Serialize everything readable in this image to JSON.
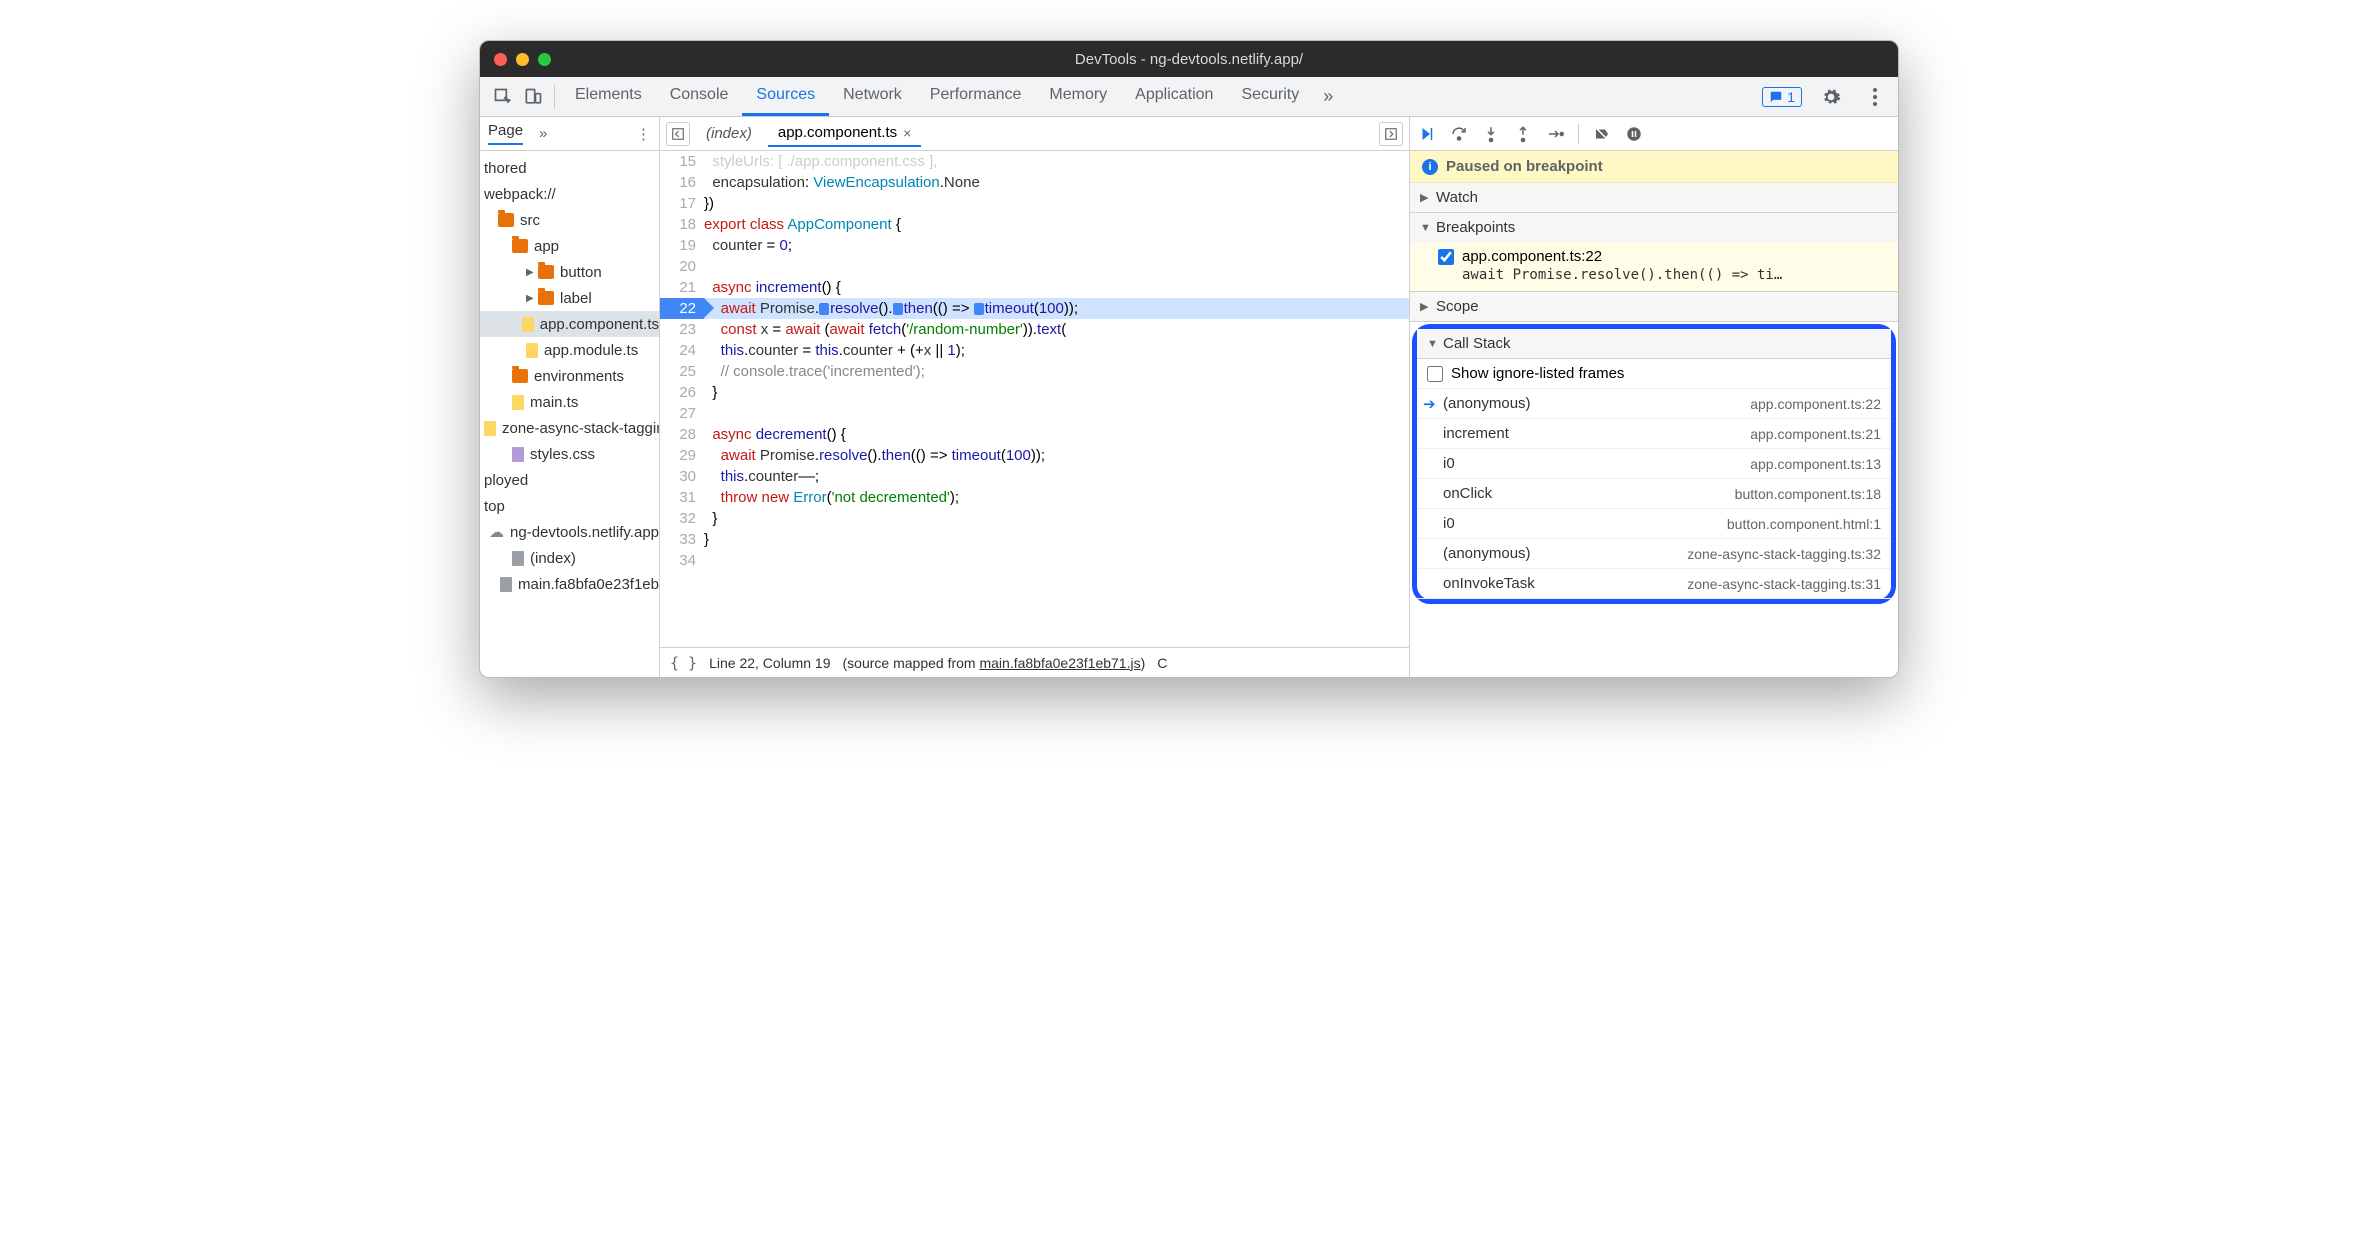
{
  "title": "DevTools - ng-devtools.netlify.app/",
  "toolbar": {
    "tabs": [
      "Elements",
      "Console",
      "Sources",
      "Network",
      "Performance",
      "Memory",
      "Application",
      "Security"
    ],
    "active": "Sources",
    "issue_count": "1"
  },
  "nav": {
    "tab": "Page",
    "items": [
      {
        "label": "thored",
        "indent": 0,
        "type": "text"
      },
      {
        "label": "webpack://",
        "indent": 0,
        "type": "text"
      },
      {
        "label": "src",
        "indent": 1,
        "type": "folder"
      },
      {
        "label": "app",
        "indent": 2,
        "type": "folder"
      },
      {
        "label": "button",
        "indent": 3,
        "type": "folder",
        "expander": "▶"
      },
      {
        "label": "label",
        "indent": 3,
        "type": "folder",
        "expander": "▶"
      },
      {
        "label": "app.component.ts",
        "indent": 3,
        "type": "file",
        "sel": true
      },
      {
        "label": "app.module.ts",
        "indent": 3,
        "type": "file"
      },
      {
        "label": "environments",
        "indent": 2,
        "type": "folder"
      },
      {
        "label": "main.ts",
        "indent": 2,
        "type": "file"
      },
      {
        "label": "zone-async-stack-tagging",
        "indent": 2,
        "type": "file",
        "trunc": true
      },
      {
        "label": "styles.css",
        "indent": 2,
        "type": "file",
        "css": true
      },
      {
        "label": "ployed",
        "indent": 0,
        "type": "text"
      },
      {
        "label": "top",
        "indent": 0,
        "type": "text"
      },
      {
        "label": "ng-devtools.netlify.app",
        "indent": 1,
        "type": "cloud"
      },
      {
        "label": "(index)",
        "indent": 2,
        "type": "file",
        "gray": true
      },
      {
        "label": "main.fa8bfa0e23f1eb",
        "indent": 2,
        "type": "file",
        "gray": true,
        "trunc": true
      }
    ]
  },
  "editor": {
    "tab_inactive": "(index)",
    "tab_active": "app.component.ts",
    "status": {
      "line_col": "Line 22, Column 19",
      "mapped_prefix": "(source mapped from ",
      "mapped_link": "main.fa8bfa0e23f1eb71.js",
      "mapped_suffix": ")",
      "coverage_short": "C"
    },
    "lines": [
      {
        "n": 15,
        "raw": "styleUrls: [ ./app.component.css ],",
        "off": true
      },
      {
        "n": 16,
        "t": [
          [
            "  ",
            "p"
          ],
          [
            "encapsulation",
            "id"
          ],
          [
            ": ",
            "p"
          ],
          [
            "ViewEncapsulation",
            "cls"
          ],
          [
            ".",
            "p"
          ],
          [
            "None",
            "id"
          ]
        ]
      },
      {
        "n": 17,
        "t": [
          [
            "})",
            "p"
          ]
        ]
      },
      {
        "n": 18,
        "t": [
          [
            "export",
            "kw"
          ],
          [
            " ",
            "p"
          ],
          [
            "class",
            "kw"
          ],
          [
            " ",
            "p"
          ],
          [
            "AppComponent",
            "cls"
          ],
          [
            " {",
            "p"
          ]
        ]
      },
      {
        "n": 19,
        "t": [
          [
            "  ",
            "p"
          ],
          [
            "counter",
            "id"
          ],
          [
            " = ",
            "p"
          ],
          [
            "0",
            "num"
          ],
          [
            ";",
            "p"
          ]
        ]
      },
      {
        "n": 20,
        "t": [
          [
            "",
            "p"
          ]
        ]
      },
      {
        "n": 21,
        "t": [
          [
            "  ",
            "p"
          ],
          [
            "async",
            "kw"
          ],
          [
            " ",
            "p"
          ],
          [
            "increment",
            "fn"
          ],
          [
            "() {",
            "p"
          ]
        ]
      },
      {
        "n": 22,
        "cur": true,
        "t": [
          [
            "    ",
            "p"
          ],
          [
            "await",
            "kw"
          ],
          [
            " ",
            "p"
          ],
          [
            "Promise",
            "id"
          ],
          [
            ".",
            "p"
          ],
          [
            "HINT",
            ""
          ],
          [
            "resolve",
            "fn"
          ],
          [
            "().",
            "p"
          ],
          [
            "HINT",
            ""
          ],
          [
            "then",
            "fn"
          ],
          [
            "(() => ",
            "p"
          ],
          [
            "HINT",
            ""
          ],
          [
            "timeout",
            "fn"
          ],
          [
            "(",
            "p"
          ],
          [
            "100",
            "num"
          ],
          [
            "));",
            "p"
          ]
        ]
      },
      {
        "n": 23,
        "t": [
          [
            "    ",
            "p"
          ],
          [
            "const",
            "kw"
          ],
          [
            " ",
            "p"
          ],
          [
            "x",
            "id"
          ],
          [
            " = ",
            "p"
          ],
          [
            "await",
            "kw"
          ],
          [
            " (",
            "p"
          ],
          [
            "await",
            "kw"
          ],
          [
            " ",
            "p"
          ],
          [
            "fetch",
            "fn"
          ],
          [
            "(",
            "p"
          ],
          [
            "'/random-number'",
            "str"
          ],
          [
            ")).",
            "p"
          ],
          [
            "text",
            "fn"
          ],
          [
            "(",
            "p"
          ]
        ]
      },
      {
        "n": 24,
        "t": [
          [
            "    ",
            "p"
          ],
          [
            "this",
            "this"
          ],
          [
            ".",
            "p"
          ],
          [
            "counter",
            "id"
          ],
          [
            " = ",
            "p"
          ],
          [
            "this",
            "this"
          ],
          [
            ".",
            "p"
          ],
          [
            "counter",
            "id"
          ],
          [
            " + (+",
            "p"
          ],
          [
            "x",
            "id"
          ],
          [
            " || ",
            "p"
          ],
          [
            "1",
            "num"
          ],
          [
            ");",
            "p"
          ]
        ]
      },
      {
        "n": 25,
        "t": [
          [
            "    ",
            "p"
          ],
          [
            "// console.trace('incremented');",
            "cmt"
          ]
        ]
      },
      {
        "n": 26,
        "t": [
          [
            "  }",
            "p"
          ]
        ]
      },
      {
        "n": 27,
        "t": [
          [
            "",
            "p"
          ]
        ]
      },
      {
        "n": 28,
        "t": [
          [
            "  ",
            "p"
          ],
          [
            "async",
            "kw"
          ],
          [
            " ",
            "p"
          ],
          [
            "decrement",
            "fn"
          ],
          [
            "() {",
            "p"
          ]
        ]
      },
      {
        "n": 29,
        "t": [
          [
            "    ",
            "p"
          ],
          [
            "await",
            "kw"
          ],
          [
            " ",
            "p"
          ],
          [
            "Promise",
            "id"
          ],
          [
            ".",
            "p"
          ],
          [
            "resolve",
            "fn"
          ],
          [
            "().",
            "p"
          ],
          [
            "then",
            "fn"
          ],
          [
            "(() => ",
            "p"
          ],
          [
            "timeout",
            "fn"
          ],
          [
            "(",
            "p"
          ],
          [
            "100",
            "num"
          ],
          [
            "));",
            "p"
          ]
        ]
      },
      {
        "n": 30,
        "t": [
          [
            "    ",
            "p"
          ],
          [
            "this",
            "this"
          ],
          [
            ".",
            "p"
          ],
          [
            "counter",
            "id"
          ],
          [
            "––;",
            "p"
          ]
        ]
      },
      {
        "n": 31,
        "t": [
          [
            "    ",
            "p"
          ],
          [
            "throw",
            "kw"
          ],
          [
            " ",
            "p"
          ],
          [
            "new",
            "kw"
          ],
          [
            " ",
            "p"
          ],
          [
            "Error",
            "cls"
          ],
          [
            "(",
            "p"
          ],
          [
            "'not decremented'",
            "str"
          ],
          [
            ");",
            "p"
          ]
        ]
      },
      {
        "n": 32,
        "t": [
          [
            "  }",
            "p"
          ]
        ]
      },
      {
        "n": 33,
        "t": [
          [
            "}",
            "p"
          ]
        ]
      },
      {
        "n": 34,
        "t": [
          [
            "",
            "p"
          ]
        ]
      }
    ]
  },
  "debugger": {
    "paused": "Paused on breakpoint",
    "sections": {
      "watch": "Watch",
      "breakpoints": "Breakpoints",
      "scope": "Scope",
      "callstack": "Call Stack"
    },
    "bp": {
      "label": "app.component.ts:22",
      "code": "await Promise.resolve().then(() => ti…"
    },
    "show_ignored": "Show ignore-listed frames",
    "frames": [
      {
        "name": "(anonymous)",
        "loc": "app.component.ts:22",
        "current": true
      },
      {
        "name": "increment",
        "loc": "app.component.ts:21"
      },
      {
        "name": "i0",
        "loc": "app.component.ts:13"
      },
      {
        "name": "onClick",
        "loc": "button.component.ts:18"
      },
      {
        "name": "i0",
        "loc": "button.component.html:1"
      },
      {
        "name": "(anonymous)",
        "loc": "zone-async-stack-tagging.ts:32"
      },
      {
        "name": "onInvokeTask",
        "loc": "zone-async-stack-tagging.ts:31"
      }
    ]
  }
}
